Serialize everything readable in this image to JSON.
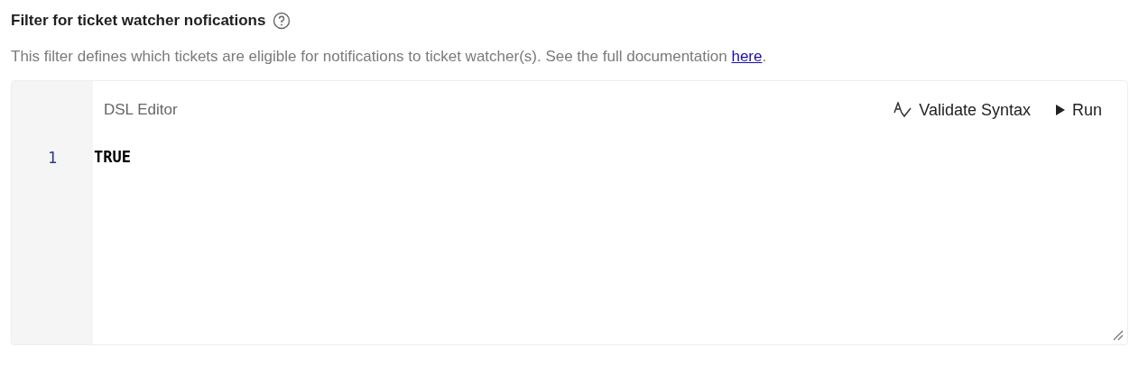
{
  "section": {
    "title": "Filter for ticket watcher nofications",
    "description": "This filter defines which tickets are eligible for notifications to ticket watcher(s). See the full documentation ",
    "link": "here",
    "after_link": "."
  },
  "editor": {
    "label": "DSL Editor",
    "actions": [
      {
        "kind": "validate",
        "label": "Validate Syntax"
      },
      {
        "kind": "run",
        "label": "Run"
      }
    ],
    "lines": [
      {
        "number": "1",
        "code": "TRUE"
      }
    ]
  }
}
